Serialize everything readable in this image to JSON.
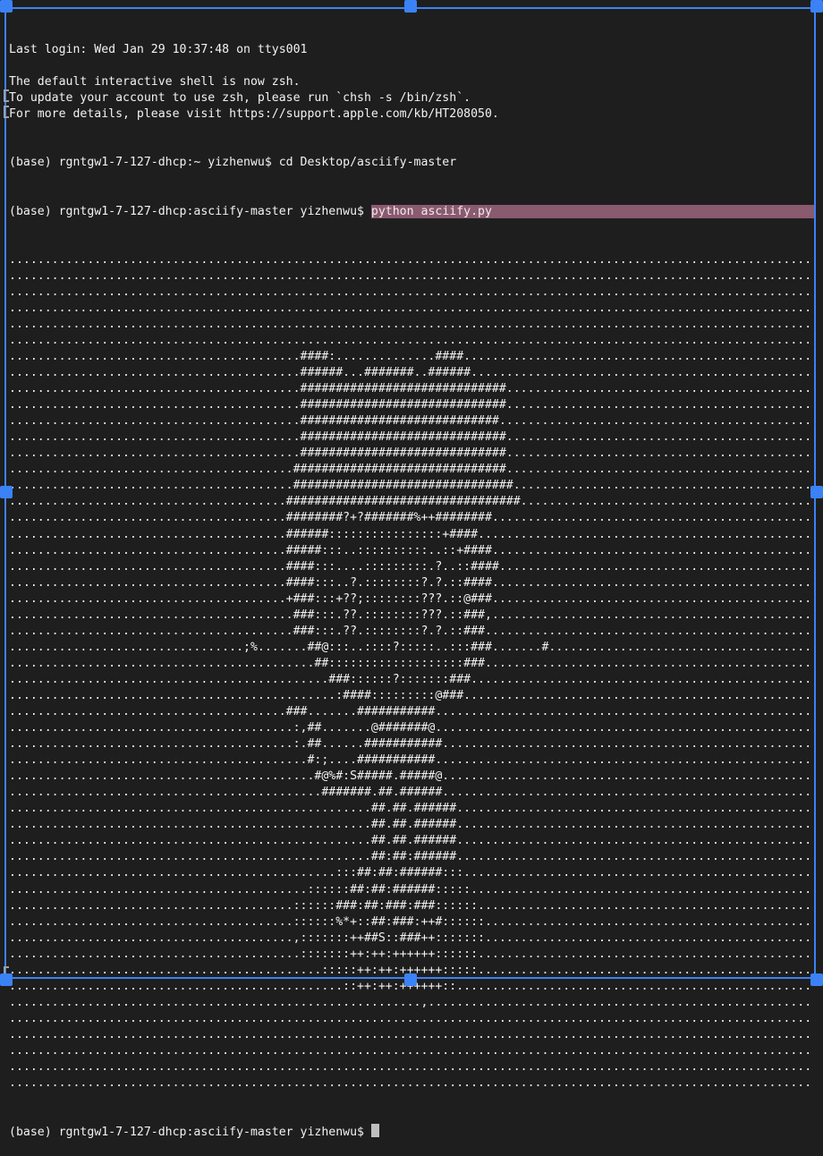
{
  "terminal": {
    "header": [
      "Last login: Wed Jan 29 10:37:48 on ttys001",
      "",
      "The default interactive shell is now zsh.",
      "To update your account to use zsh, please run `chsh -s /bin/zsh`.",
      "For more details, please visit https://support.apple.com/kb/HT208050."
    ],
    "cmd1": "(base) rgntgw1-7-127-dhcp:~ yizhenwu$ cd Desktop/asciify-master",
    "cmd2_prompt": "(base) rgntgw1-7-127-dhcp:asciify-master yizhenwu$ ",
    "cmd2_command": "python asciify.py",
    "final_prompt": "(base) rgntgw1-7-127-dhcp:asciify-master yizhenwu$ ",
    "ascii_art": [
      "...................................................................................................................",
      "...................................................................................................................",
      "...................................................................................................................",
      "...................................................................................................................",
      "...................................................................................................................",
      "...................................................................................................................",
      ".........................................####:..............####...................................................",
      ".........................................######...#######..######..................................................",
      ".........................................#############################.............................................",
      ".........................................#############################.............................................",
      ".........................................############################..............................................",
      ".........................................#############################.............................................",
      ".........................................#############################.............................................",
      "........................................##############################.............................................",
      "........................................###############################............................................",
      ".......................................#################################...........................................",
      ".......................................########?+?#######%++########...............................................",
      ".......................................######::::::::::::::::+####................................................",
      ".......................................#####:::..::::::::::..::+####...............................................",
      ".......................................####:::....:::::::::.?..::####..............................................",
      ".......................................####:::..?.::::::::?.?.::####...............................................",
      ".......................................+###:::+??;::::::::???.::@###..............................................",
      "........................................###:::.??.::::::::???.::###,..............................................",
      "........................................###:::.??.::::::::?.?.::###...............................................",
      ".................................;%.......##@:::..::::?:::::..:::###.......#.......................................",
      "...........................................##:::::::::::::::::::###...............................................",
      ".............................................###::::::?:::::::###.................................................",
      "..............................................:####:::::::::@###..................................................",
      ".......................................###.......###########.......................................................",
      "........................................:,##.......@#######@.......................................................",
      "........................................:.##......###########......................................................",
      "..........................................#:;....###########.......................................................",
      "...........................................#@%#:S#####.#####@.......................................................",
      "............................................#######.##.######......................................................",
      "...................................................##.##.######....................................................",
      "...................................................##.##.######....................................................",
      "...................................................##.##.######....................................................",
      "...................................................##:##:######....................................................",
      "..............................................:::##:##:######:::...................................................",
      "..........................................::::::##:##:######:::::..................................................",
      "........................................::::::###:##:###:###::::::.................................................",
      "........................................::::::%*+::##:###:++#::::::................................................",
      "........................................,:::::::++##S::###++:::::::................................................",
      ".........................................:::::::++:++:++++++::::::.................................................",
      "............................................:::::++:++:++++++:::::..................................................",
      "...............................................::++:++:++++++::.....................................................",
      "..........................................................,.........................................................",
      "...................................................................................................................",
      "...................................................................................................................",
      "...................................................................................................................",
      "...................................................................................................................",
      "..................................................................................................................."
    ]
  }
}
